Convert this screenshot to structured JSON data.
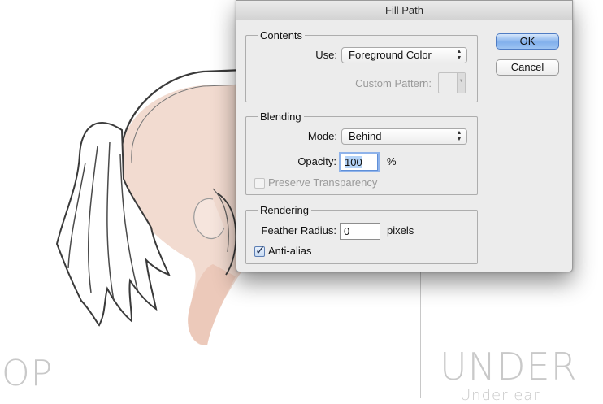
{
  "canvas": {
    "left_text": "OP",
    "right_text": "UNDER",
    "right_subtext": "Under ear",
    "skin_color": "#f2dbd0",
    "line_color": "#3a3a3a"
  },
  "dialog": {
    "title": "Fill Path",
    "contents": {
      "legend": "Contents",
      "use_label": "Use:",
      "use_value": "Foreground Color",
      "custom_pattern_label": "Custom Pattern:"
    },
    "blending": {
      "legend": "Blending",
      "mode_label": "Mode:",
      "mode_value": "Behind",
      "opacity_label": "Opacity:",
      "opacity_value": "100",
      "opacity_unit": "%",
      "preserve_label": "Preserve Transparency",
      "preserve_checked": false
    },
    "rendering": {
      "legend": "Rendering",
      "feather_label": "Feather Radius:",
      "feather_value": "0",
      "feather_unit": "pixels",
      "antialias_label": "Anti-alias",
      "antialias_checked": true
    },
    "buttons": {
      "ok": "OK",
      "cancel": "Cancel"
    },
    "accent_color": "#82b0ec"
  }
}
